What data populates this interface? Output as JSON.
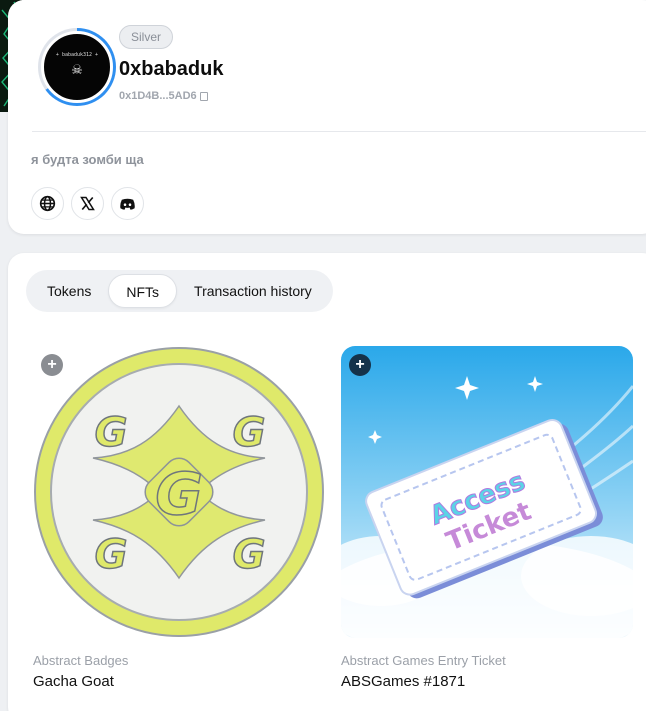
{
  "profile": {
    "avatar_text": "+ babaduk312 +",
    "tier": "Silver",
    "username": "0xbabaduk",
    "address": "0x1D4B...5AD6",
    "bio": "я будта зомби ща",
    "socials": [
      {
        "icon": "globe-icon",
        "glyph": "🌐"
      },
      {
        "icon": "x-icon",
        "glyph": "𝕏"
      },
      {
        "icon": "discord-icon",
        "glyph": "◉"
      }
    ]
  },
  "tabs": [
    {
      "label": "Tokens",
      "active": false
    },
    {
      "label": "NFTs",
      "active": true
    },
    {
      "label": "Transaction history",
      "active": false
    }
  ],
  "nfts": [
    {
      "collection": "Abstract Badges",
      "name": "Gacha Goat",
      "image_text": "G"
    },
    {
      "collection": "Abstract Games Entry Ticket",
      "name": "ABSGames #1871",
      "image_text": "Access Ticket"
    }
  ],
  "colors": {
    "accent": "#2f8ff0",
    "badge_yellow": "#dfe96a",
    "ticket_sky": "#2aa8ea"
  }
}
